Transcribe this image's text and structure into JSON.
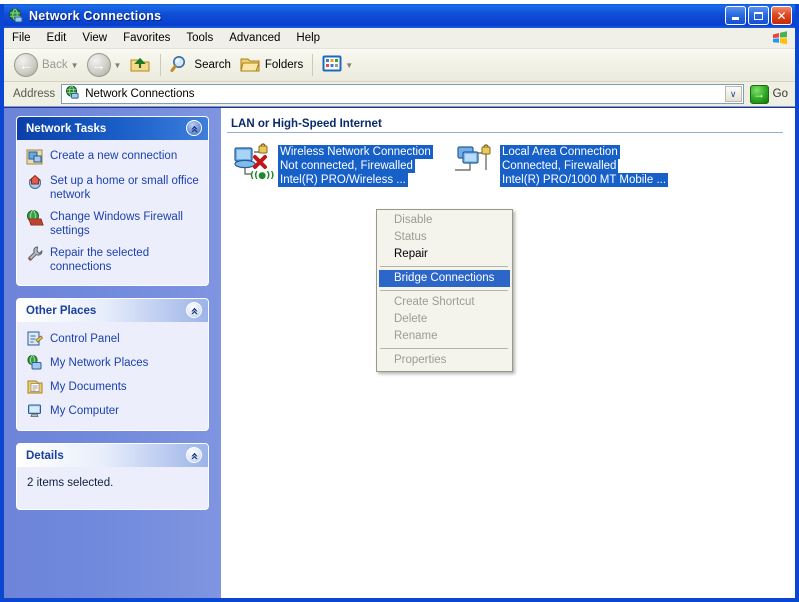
{
  "window": {
    "title": "Network Connections",
    "title_icon": "globe-network-icon",
    "buttons": {
      "minimize": "minimize",
      "maximize": "maximize",
      "close": "close"
    }
  },
  "menubar": {
    "items": [
      "File",
      "Edit",
      "View",
      "Favorites",
      "Tools",
      "Advanced",
      "Help"
    ],
    "logo": "windows-flag-logo"
  },
  "toolbar": {
    "back_label": "Back",
    "back_icon": "back-arrow-icon",
    "forward_icon": "forward-arrow-icon",
    "up_icon": "up-folder-icon",
    "search_label": "Search",
    "search_icon": "magnifier-icon",
    "folders_label": "Folders",
    "folders_icon": "folder-icon",
    "views_icon": "views-icon",
    "dropdown_glyph": "▼"
  },
  "addressbar": {
    "label": "Address",
    "value": "Network Connections",
    "icon": "globe-network-icon",
    "dropdown_glyph": "∨",
    "go_label": "Go",
    "go_glyph": "→"
  },
  "sidebar": {
    "panels": [
      {
        "title": "Network Tasks",
        "style": "dark",
        "collapse_glyph": "«",
        "items": [
          {
            "label": "Create a new connection",
            "icon": "new-connection-icon"
          },
          {
            "label": "Set up a home or small office network",
            "icon": "home-network-icon"
          },
          {
            "label": "Change Windows Firewall settings",
            "icon": "firewall-icon"
          },
          {
            "label": "Repair the selected connections",
            "icon": "wrench-icon"
          }
        ]
      },
      {
        "title": "Other Places",
        "style": "light",
        "collapse_glyph": "«",
        "items": [
          {
            "label": "Control Panel",
            "icon": "control-panel-icon"
          },
          {
            "label": "My Network Places",
            "icon": "network-places-icon"
          },
          {
            "label": "My Documents",
            "icon": "documents-icon"
          },
          {
            "label": "My Computer",
            "icon": "computer-icon"
          }
        ]
      },
      {
        "title": "Details",
        "style": "light",
        "collapse_glyph": "«",
        "status_text": "2 items selected."
      }
    ]
  },
  "content": {
    "group_header": "LAN or High-Speed Internet",
    "connections": [
      {
        "name": "Wireless Network Connection",
        "status": "Not connected, Firewalled",
        "adapter": "Intel(R) PRO/Wireless ...",
        "icon": "wireless-adapter-icon",
        "selected": true
      },
      {
        "name": "Local Area Connection",
        "status": "Connected, Firewalled",
        "adapter": "Intel(R) PRO/1000 MT Mobile ...",
        "icon": "lan-adapter-icon",
        "selected": true
      }
    ]
  },
  "context_menu": {
    "items": [
      {
        "label": "Disable",
        "enabled": false,
        "selected": false
      },
      {
        "label": "Status",
        "enabled": false,
        "selected": false
      },
      {
        "label": "Repair",
        "enabled": true,
        "selected": false
      },
      {
        "separator": true
      },
      {
        "label": "Bridge Connections",
        "enabled": true,
        "selected": true
      },
      {
        "separator": true
      },
      {
        "label": "Create Shortcut",
        "enabled": false,
        "selected": false
      },
      {
        "label": "Delete",
        "enabled": false,
        "selected": false
      },
      {
        "label": "Rename",
        "enabled": false,
        "selected": false
      },
      {
        "separator": true
      },
      {
        "label": "Properties",
        "enabled": false,
        "selected": false
      }
    ]
  },
  "colors": {
    "titlebar_blue": "#0A3FCE",
    "selection_blue": "#1660C8",
    "menu_highlight": "#2C66C8",
    "sidebar_bg": "#7089DC",
    "panel_bg": "#ECEFFB",
    "link_blue": "#1B3FAE"
  }
}
